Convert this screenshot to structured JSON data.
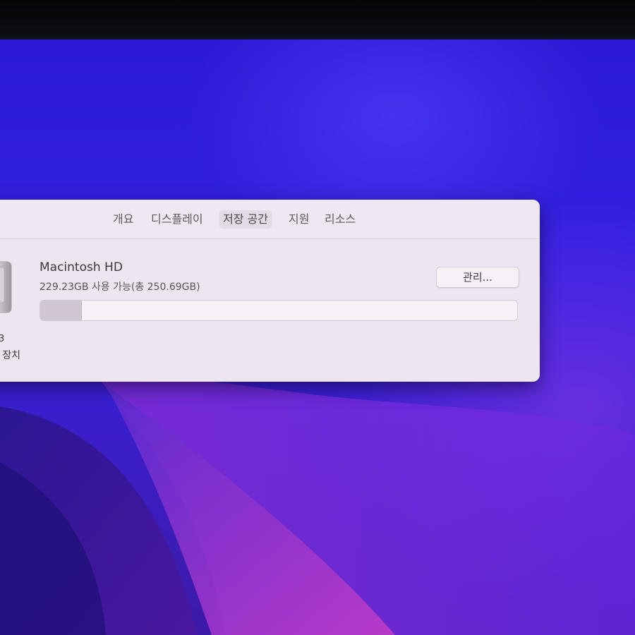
{
  "window": {
    "tabs": [
      {
        "label": "개요",
        "active": false
      },
      {
        "label": "디스플레이",
        "active": false
      },
      {
        "label": "저장 공간",
        "active": true
      },
      {
        "label": "지원",
        "active": false
      },
      {
        "label": "리소스",
        "active": false
      }
    ]
  },
  "storage": {
    "icon": "hard-drive-icon",
    "side_label_line1": "3",
    "side_label_line2": "' 장치",
    "volume_name": "Macintosh HD",
    "space_text": "229.23GB 사용 가능(총 250.69GB)",
    "used_fraction": 0.086,
    "manage_label": "관리..."
  },
  "colors": {
    "wallpaper_base": "#3320e0",
    "window_bg": "#ede5ef",
    "bar_fill": "#cfc6d1"
  }
}
